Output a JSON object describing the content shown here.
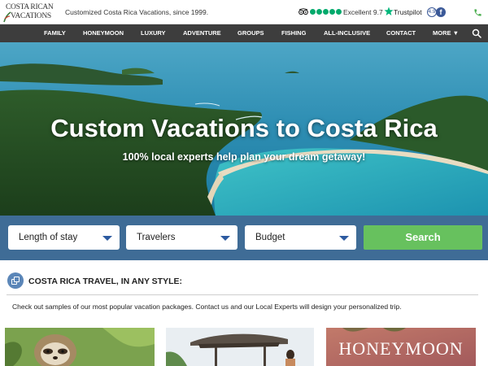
{
  "header": {
    "logo_line1": "COSTA RICAN",
    "logo_line2": "VACATIONS",
    "tagline": "Customized Costa Rica Vacations, since 1999.",
    "review_text": "Excellent 9.7",
    "review_brand": "Trustpilot",
    "rating_badge": "4.9",
    "facebook_glyph": "f"
  },
  "nav": {
    "items": [
      "FAMILY",
      "HONEYMOON",
      "LUXURY",
      "ADVENTURE",
      "GROUPS",
      "FISHING",
      "ALL-INCLUSIVE",
      "CONTACT",
      "MORE ▼"
    ]
  },
  "hero": {
    "title": "Custom Vacations to Costa Rica",
    "subtitle": "100% local experts help plan your dream getaway!"
  },
  "search": {
    "length_of_stay": "Length of stay",
    "travelers": "Travelers",
    "budget": "Budget",
    "button": "Search"
  },
  "section": {
    "title": "COSTA RICA TRAVEL, IN ANY STYLE:",
    "intro": "Check out samples of our most popular vacation packages. Contact us and our Local Experts will design your personalized trip."
  },
  "cards": {
    "honeymoon_label": "HONEYMOON"
  },
  "colors": {
    "nav_bg": "#3d3d3d",
    "search_band": "#3f6c96",
    "search_button": "#67c15e",
    "tripadvisor": "#00aa6c",
    "trustpilot_star": "#00b67a",
    "facebook": "#3b5998"
  },
  "icons": [
    "tripadvisor-icon",
    "trustpilot-star-icon",
    "facebook-icon",
    "phone-icon",
    "search-icon",
    "section-copy-icon"
  ]
}
